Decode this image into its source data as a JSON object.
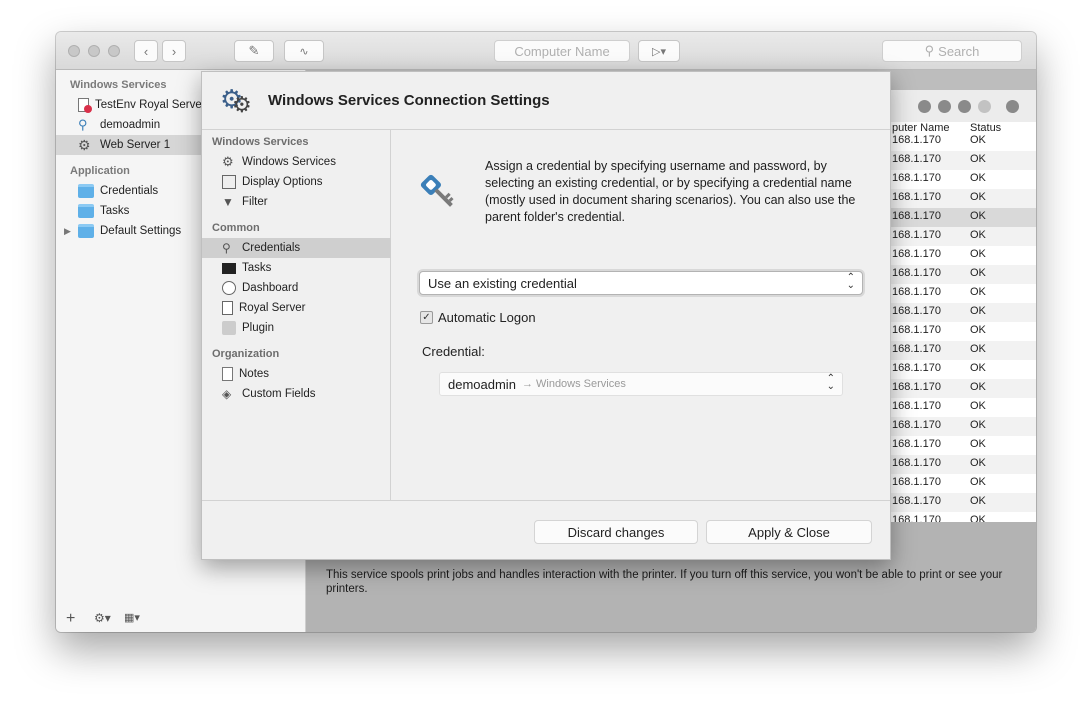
{
  "toolbar": {
    "computer_name_placeholder": "Computer Name",
    "search_placeholder": "Search"
  },
  "sidebar": {
    "group1": "Windows Services",
    "items1": [
      "TestEnv Royal Serve",
      "demoadmin",
      "Web Server 1"
    ],
    "group2": "Application",
    "items2": [
      "Credentials",
      "Tasks",
      "Default Settings"
    ]
  },
  "table": {
    "col_name": "puter Name",
    "col_status": "Status",
    "rows": [
      {
        "name": "168.1.170",
        "status": "OK"
      },
      {
        "name": "168.1.170",
        "status": "OK"
      },
      {
        "name": "168.1.170",
        "status": "OK"
      },
      {
        "name": "168.1.170",
        "status": "OK"
      },
      {
        "name": "168.1.170",
        "status": "OK"
      },
      {
        "name": "168.1.170",
        "status": "OK"
      },
      {
        "name": "168.1.170",
        "status": "OK"
      },
      {
        "name": "168.1.170",
        "status": "OK"
      },
      {
        "name": "168.1.170",
        "status": "OK"
      },
      {
        "name": "168.1.170",
        "status": "OK"
      },
      {
        "name": "168.1.170",
        "status": "OK"
      },
      {
        "name": "168.1.170",
        "status": "OK"
      },
      {
        "name": "168.1.170",
        "status": "OK"
      },
      {
        "name": "168.1.170",
        "status": "OK"
      },
      {
        "name": "168.1.170",
        "status": "OK"
      },
      {
        "name": "168.1.170",
        "status": "OK"
      },
      {
        "name": "168.1.170",
        "status": "OK"
      },
      {
        "name": "168.1.170",
        "status": "OK"
      },
      {
        "name": "168.1.170",
        "status": "OK"
      },
      {
        "name": "168.1.170",
        "status": "OK"
      },
      {
        "name": "168.1.170",
        "status": "OK"
      }
    ]
  },
  "description": "This service spools print jobs and handles interaction with the printer.  If you turn off this service, you won't be able to print or see your printers.",
  "sheet": {
    "title": "Windows Services Connection Settings",
    "nav_group1": "Windows Services",
    "nav_items1": [
      "Windows Services",
      "Display Options",
      "Filter"
    ],
    "nav_group2": "Common",
    "nav_items2": [
      "Credentials",
      "Tasks",
      "Dashboard",
      "Royal Server",
      "Plugin"
    ],
    "nav_group3": "Organization",
    "nav_items3": [
      "Notes",
      "Custom Fields"
    ],
    "info": "Assign a credential by specifying username and password, by selecting an existing credential, or by specifying a credential name (mostly used in document sharing scenarios). You can also use the parent folder's credential.",
    "mode_value": "Use an existing credential",
    "auto_logon_label": "Automatic Logon",
    "credential_label": "Credential:",
    "credential_name": "demoadmin",
    "credential_path": "→ Windows Services",
    "discard_label": "Discard changes",
    "apply_label": "Apply & Close"
  },
  "colors": {
    "folder": "#5fb0e8",
    "key": "#3b7fb8",
    "badge": "#d9304a"
  }
}
